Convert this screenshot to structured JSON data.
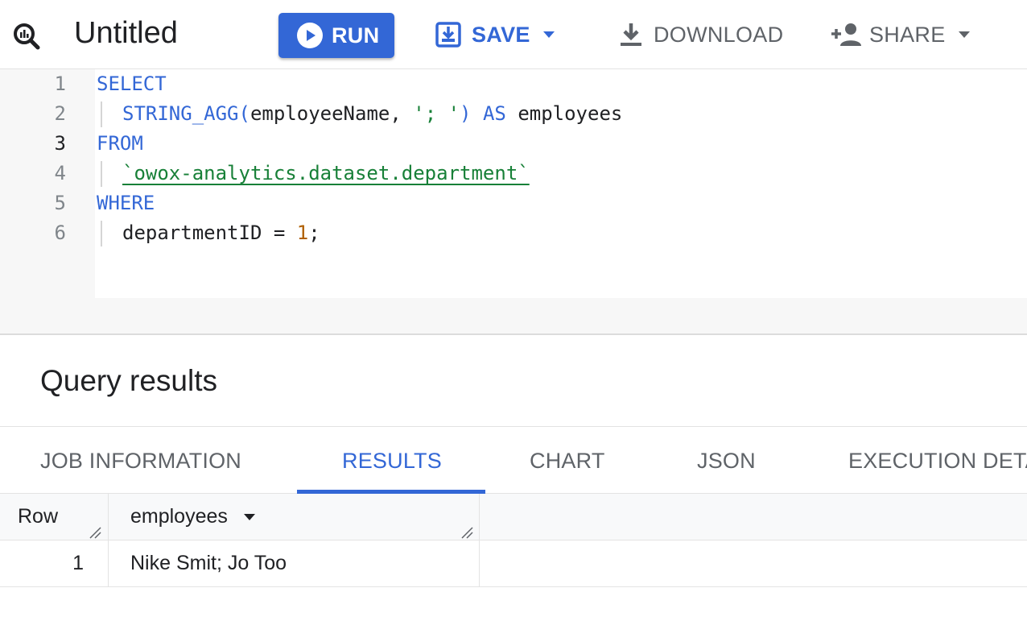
{
  "toolbar": {
    "title": "Untitled",
    "run_label": "RUN",
    "save_label": "SAVE",
    "download_label": "DOWNLOAD",
    "share_label": "SHARE",
    "accent_color": "#3367d6"
  },
  "editor": {
    "lines": [
      {
        "number": "1",
        "text": "SELECT"
      },
      {
        "number": "2",
        "fn": "STRING_AGG(",
        "arg": "employeeName, ",
        "sep": "'; '",
        "close": ")",
        "as": "AS",
        "alias": "employees"
      },
      {
        "number": "3",
        "text": "FROM"
      },
      {
        "number": "4",
        "table": "`owox-analytics.dataset.department`"
      },
      {
        "number": "5",
        "text": "WHERE"
      },
      {
        "number": "6",
        "cond": "departmentID = ",
        "value": "1",
        "end": ";"
      }
    ]
  },
  "results": {
    "title": "Query results",
    "tabs": [
      "JOB INFORMATION",
      "RESULTS",
      "CHART",
      "JSON",
      "EXECUTION DETAILS"
    ],
    "active_tab": "RESULTS",
    "columns": [
      "Row",
      "employees"
    ],
    "rows": [
      {
        "row": "1",
        "employees": "Nike Smit; Jo Too"
      }
    ]
  }
}
